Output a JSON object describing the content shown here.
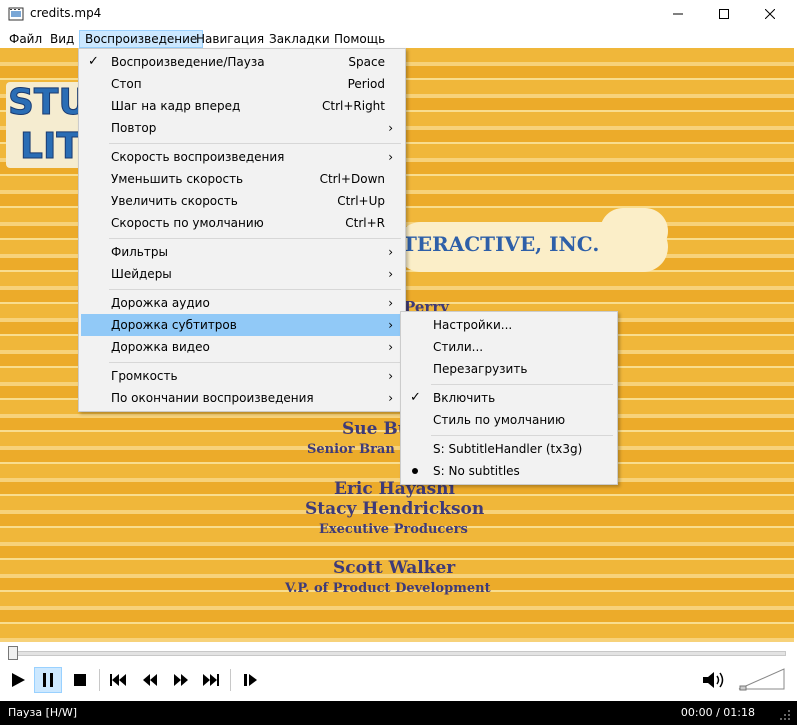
{
  "window": {
    "title": "credits.mp4",
    "app_icon": "film-icon",
    "buttons": [
      "minimize-icon",
      "maximize-icon",
      "close-icon"
    ]
  },
  "menubar": [
    "Файл",
    "Вид",
    "Воспроизведение",
    "Навигация",
    "Закладки",
    "Помощь"
  ],
  "video": {
    "logo_lines": [
      "STU",
      "LIT"
    ],
    "company": "TERACTIVE, INC.",
    "partial": "Perry",
    "names": [
      "Sue Bu",
      "Senior Bran",
      "Eric Hayashi",
      "Stacy Hendrickson",
      "Executive Producers",
      "Scott Walker",
      "V.P. of Product Development"
    ]
  },
  "playback_menu": [
    {
      "label": "Воспроизведение/Пауза",
      "shortcut": "Space",
      "checked": true
    },
    {
      "label": "Стоп",
      "shortcut": "Period"
    },
    {
      "label": "Шаг на кадр вперед",
      "shortcut": "Ctrl+Right"
    },
    {
      "label": "Повтор",
      "submenu": true
    },
    {
      "label": "Скорость воспроизведения",
      "submenu": true
    },
    {
      "label": "Уменьшить скорость",
      "shortcut": "Ctrl+Down"
    },
    {
      "label": "Увеличить скорость",
      "shortcut": "Ctrl+Up"
    },
    {
      "label": "Скорость по умолчанию",
      "shortcut": "Ctrl+R"
    },
    {
      "label": "Фильтры",
      "submenu": true
    },
    {
      "label": "Шейдеры",
      "submenu": true
    },
    {
      "label": "Дорожка аудио",
      "submenu": true
    },
    {
      "label": "Дорожка субтитров",
      "submenu": true,
      "highlighted": true
    },
    {
      "label": "Дорожка видео",
      "submenu": true
    },
    {
      "label": "Громкость",
      "submenu": true
    },
    {
      "label": "По окончании воспроизведения",
      "submenu": true
    }
  ],
  "subtitle_menu": [
    {
      "label": "Настройки..."
    },
    {
      "label": "Стили..."
    },
    {
      "label": "Перезагрузить"
    },
    {
      "label": "Включить",
      "checked": true
    },
    {
      "label": "Стиль по умолчанию"
    },
    {
      "label": "S: SubtitleHandler (tx3g)"
    },
    {
      "label": "S: No subtitles",
      "radio": true
    }
  ],
  "controls": {
    "icons": [
      "play-icon",
      "pause-icon",
      "stop-icon",
      "skip-back-icon",
      "rewind-icon",
      "fast-forward-icon",
      "skip-forward-icon",
      "frame-step-icon",
      "volume-icon"
    ],
    "seek_position": 0
  },
  "status": {
    "state": "Пауза [H/W]",
    "time": "00:00 / 01:18"
  }
}
